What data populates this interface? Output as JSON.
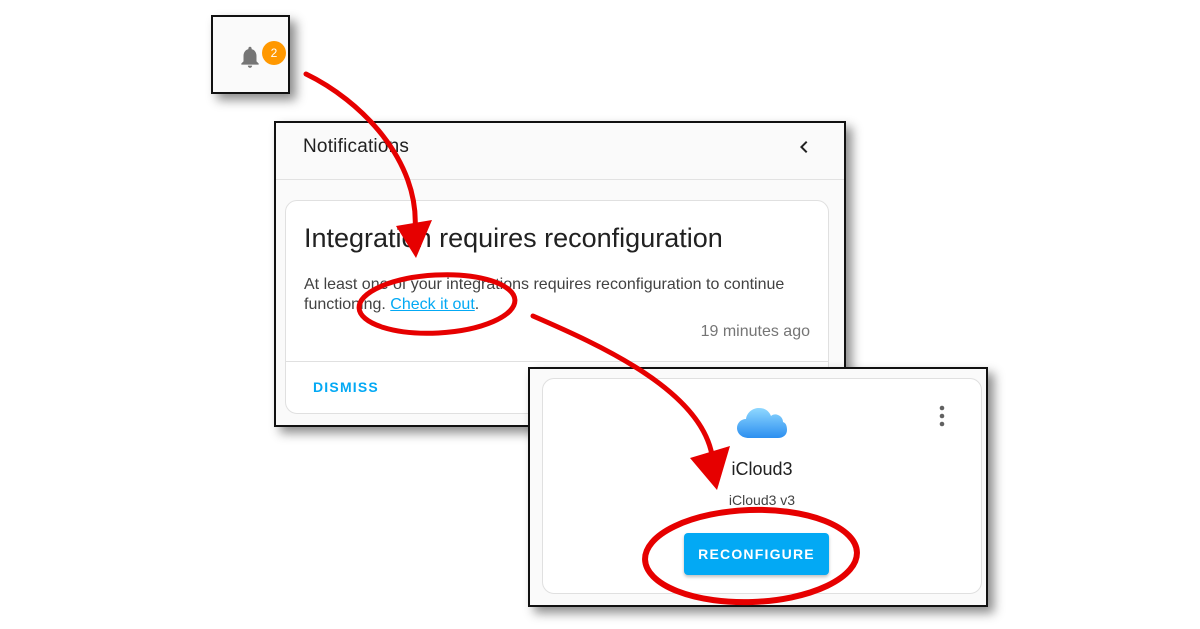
{
  "bell": {
    "icon": "bell-icon",
    "badge_count": "2",
    "badge_color": "#ff9800"
  },
  "notifications": {
    "title": "Notifications",
    "back_icon": "chevron-left-icon",
    "card": {
      "title": "Integration requires reconfiguration",
      "message_before": "At least one of your integrations requires reconfiguration to continue functioning. ",
      "link": "Check it out",
      "message_after": ".",
      "time": "19 minutes ago",
      "dismiss": "DISMISS"
    }
  },
  "integration": {
    "icon": "cloud-icon",
    "menu_icon": "kebab-menu-icon",
    "name": "iCloud3",
    "version": "iCloud3 v3",
    "reconfigure": "RECONFIGURE"
  },
  "colors": {
    "accent": "#03a9f4",
    "annotation": "#e60000"
  }
}
